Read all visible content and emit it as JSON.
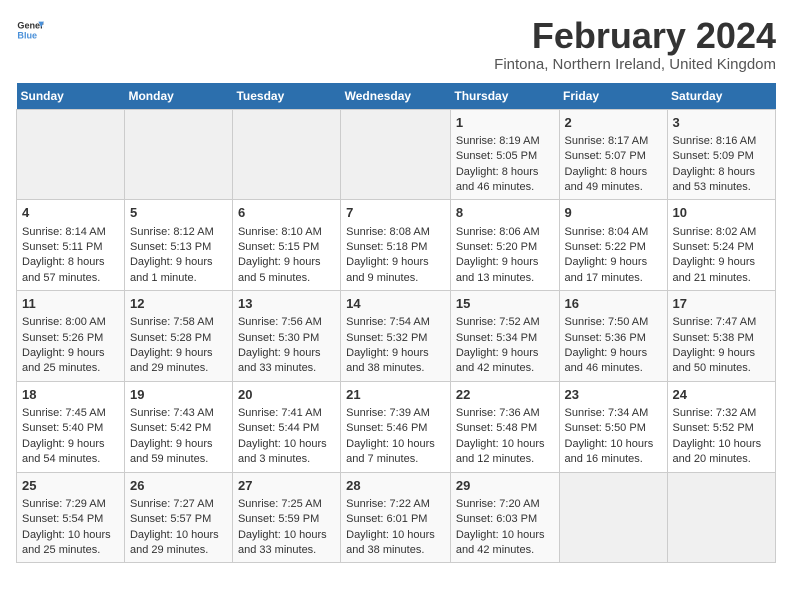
{
  "header": {
    "logo_line1": "General",
    "logo_line2": "Blue",
    "title": "February 2024",
    "subtitle": "Fintona, Northern Ireland, United Kingdom"
  },
  "calendar": {
    "days_of_week": [
      "Sunday",
      "Monday",
      "Tuesday",
      "Wednesday",
      "Thursday",
      "Friday",
      "Saturday"
    ],
    "weeks": [
      [
        {
          "day": "",
          "content": ""
        },
        {
          "day": "",
          "content": ""
        },
        {
          "day": "",
          "content": ""
        },
        {
          "day": "",
          "content": ""
        },
        {
          "day": "1",
          "content": "Sunrise: 8:19 AM\nSunset: 5:05 PM\nDaylight: 8 hours and 46 minutes."
        },
        {
          "day": "2",
          "content": "Sunrise: 8:17 AM\nSunset: 5:07 PM\nDaylight: 8 hours and 49 minutes."
        },
        {
          "day": "3",
          "content": "Sunrise: 8:16 AM\nSunset: 5:09 PM\nDaylight: 8 hours and 53 minutes."
        }
      ],
      [
        {
          "day": "4",
          "content": "Sunrise: 8:14 AM\nSunset: 5:11 PM\nDaylight: 8 hours and 57 minutes."
        },
        {
          "day": "5",
          "content": "Sunrise: 8:12 AM\nSunset: 5:13 PM\nDaylight: 9 hours and 1 minute."
        },
        {
          "day": "6",
          "content": "Sunrise: 8:10 AM\nSunset: 5:15 PM\nDaylight: 9 hours and 5 minutes."
        },
        {
          "day": "7",
          "content": "Sunrise: 8:08 AM\nSunset: 5:18 PM\nDaylight: 9 hours and 9 minutes."
        },
        {
          "day": "8",
          "content": "Sunrise: 8:06 AM\nSunset: 5:20 PM\nDaylight: 9 hours and 13 minutes."
        },
        {
          "day": "9",
          "content": "Sunrise: 8:04 AM\nSunset: 5:22 PM\nDaylight: 9 hours and 17 minutes."
        },
        {
          "day": "10",
          "content": "Sunrise: 8:02 AM\nSunset: 5:24 PM\nDaylight: 9 hours and 21 minutes."
        }
      ],
      [
        {
          "day": "11",
          "content": "Sunrise: 8:00 AM\nSunset: 5:26 PM\nDaylight: 9 hours and 25 minutes."
        },
        {
          "day": "12",
          "content": "Sunrise: 7:58 AM\nSunset: 5:28 PM\nDaylight: 9 hours and 29 minutes."
        },
        {
          "day": "13",
          "content": "Sunrise: 7:56 AM\nSunset: 5:30 PM\nDaylight: 9 hours and 33 minutes."
        },
        {
          "day": "14",
          "content": "Sunrise: 7:54 AM\nSunset: 5:32 PM\nDaylight: 9 hours and 38 minutes."
        },
        {
          "day": "15",
          "content": "Sunrise: 7:52 AM\nSunset: 5:34 PM\nDaylight: 9 hours and 42 minutes."
        },
        {
          "day": "16",
          "content": "Sunrise: 7:50 AM\nSunset: 5:36 PM\nDaylight: 9 hours and 46 minutes."
        },
        {
          "day": "17",
          "content": "Sunrise: 7:47 AM\nSunset: 5:38 PM\nDaylight: 9 hours and 50 minutes."
        }
      ],
      [
        {
          "day": "18",
          "content": "Sunrise: 7:45 AM\nSunset: 5:40 PM\nDaylight: 9 hours and 54 minutes."
        },
        {
          "day": "19",
          "content": "Sunrise: 7:43 AM\nSunset: 5:42 PM\nDaylight: 9 hours and 59 minutes."
        },
        {
          "day": "20",
          "content": "Sunrise: 7:41 AM\nSunset: 5:44 PM\nDaylight: 10 hours and 3 minutes."
        },
        {
          "day": "21",
          "content": "Sunrise: 7:39 AM\nSunset: 5:46 PM\nDaylight: 10 hours and 7 minutes."
        },
        {
          "day": "22",
          "content": "Sunrise: 7:36 AM\nSunset: 5:48 PM\nDaylight: 10 hours and 12 minutes."
        },
        {
          "day": "23",
          "content": "Sunrise: 7:34 AM\nSunset: 5:50 PM\nDaylight: 10 hours and 16 minutes."
        },
        {
          "day": "24",
          "content": "Sunrise: 7:32 AM\nSunset: 5:52 PM\nDaylight: 10 hours and 20 minutes."
        }
      ],
      [
        {
          "day": "25",
          "content": "Sunrise: 7:29 AM\nSunset: 5:54 PM\nDaylight: 10 hours and 25 minutes."
        },
        {
          "day": "26",
          "content": "Sunrise: 7:27 AM\nSunset: 5:57 PM\nDaylight: 10 hours and 29 minutes."
        },
        {
          "day": "27",
          "content": "Sunrise: 7:25 AM\nSunset: 5:59 PM\nDaylight: 10 hours and 33 minutes."
        },
        {
          "day": "28",
          "content": "Sunrise: 7:22 AM\nSunset: 6:01 PM\nDaylight: 10 hours and 38 minutes."
        },
        {
          "day": "29",
          "content": "Sunrise: 7:20 AM\nSunset: 6:03 PM\nDaylight: 10 hours and 42 minutes."
        },
        {
          "day": "",
          "content": ""
        },
        {
          "day": "",
          "content": ""
        }
      ]
    ]
  }
}
